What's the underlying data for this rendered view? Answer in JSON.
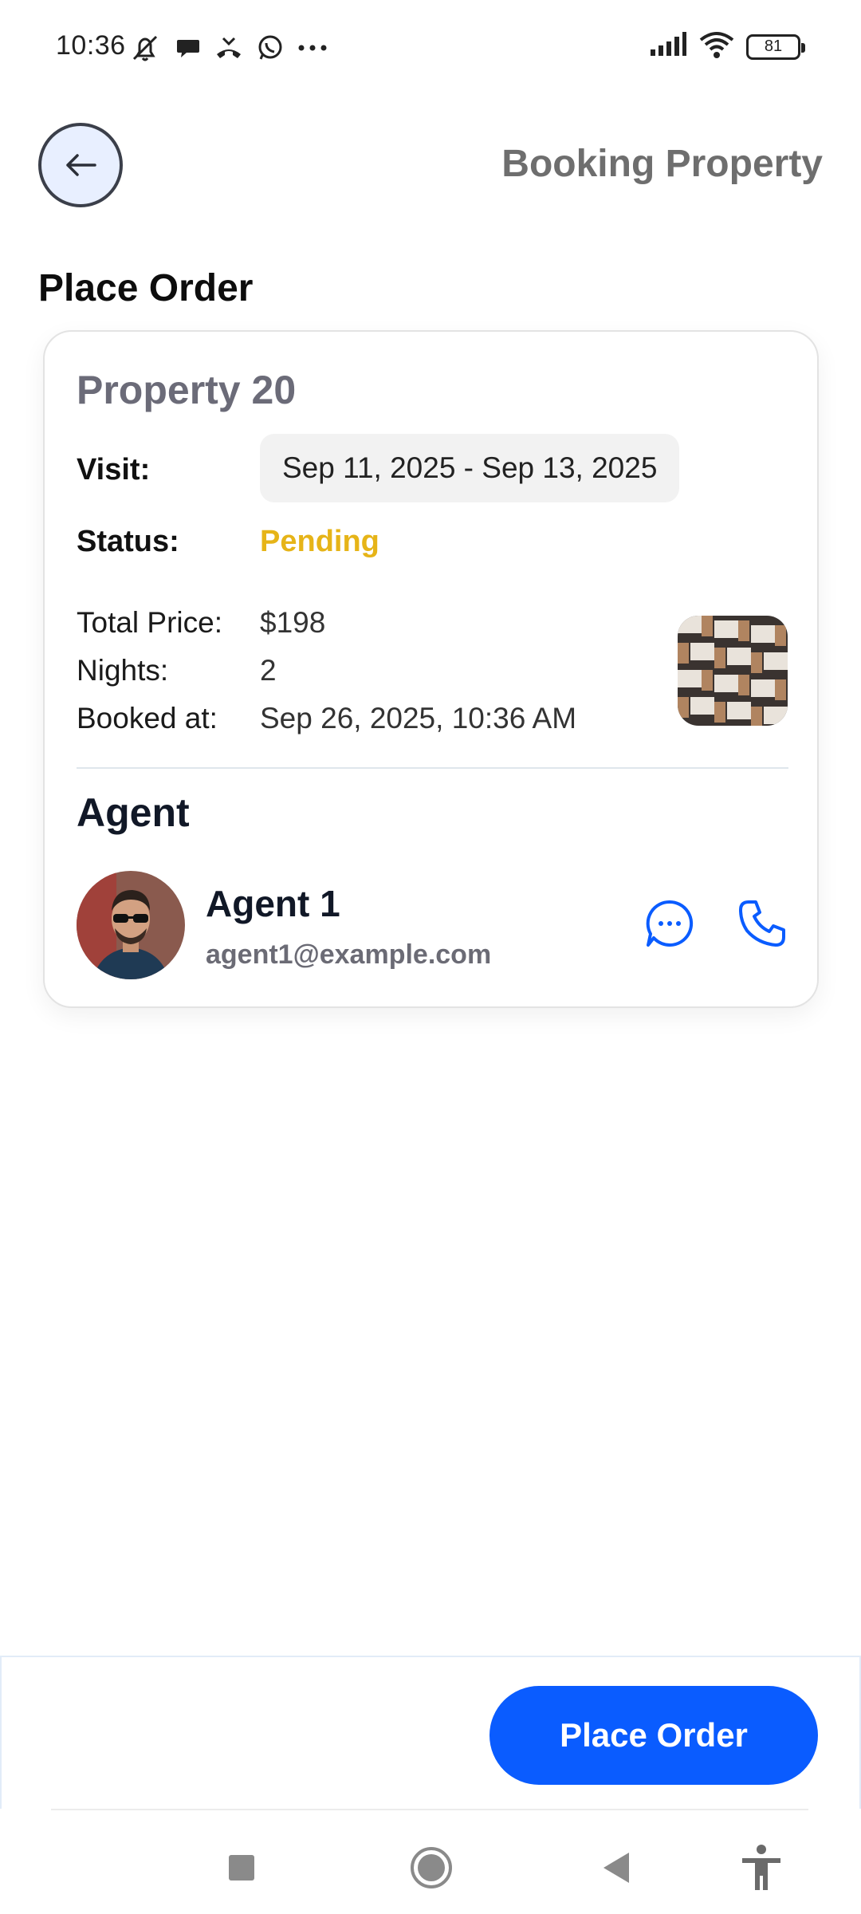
{
  "status_bar": {
    "time": "10:36",
    "battery": "81",
    "icons": [
      "muted-bell-icon",
      "chat-bubble-icon",
      "missed-call-icon",
      "whatsapp-icon",
      "more-dots-icon",
      "signal-icon",
      "wifi-icon",
      "battery-icon"
    ]
  },
  "header": {
    "title": "Booking Property",
    "back_icon": "arrow-left-icon"
  },
  "section_title": "Place Order",
  "booking": {
    "property_name": "Property 20",
    "visit_label": "Visit:",
    "visit_value": "Sep 11, 2025 - Sep 13, 2025",
    "status_label": "Status:",
    "status_value": "Pending",
    "total_price_label": "Total Price:",
    "total_price_value": "$198",
    "nights_label": "Nights:",
    "nights_value": "2",
    "booked_at_label": "Booked at:",
    "booked_at_value": "Sep 26, 2025, 10:36 AM"
  },
  "agent": {
    "heading": "Agent",
    "name": "Agent 1",
    "email": "agent1@example.com",
    "message_icon": "chat-icon",
    "call_icon": "phone-icon"
  },
  "actions": {
    "place_order_label": "Place Order"
  },
  "colors": {
    "primary": "#0a5cff",
    "pending": "#e6b418",
    "header_title": "#6e6e6e",
    "back_button_bg": "#e8efff"
  },
  "nav_bar": {
    "items": [
      "recents-square-icon",
      "home-circle-icon",
      "back-triangle-icon",
      "accessibility-icon"
    ]
  }
}
